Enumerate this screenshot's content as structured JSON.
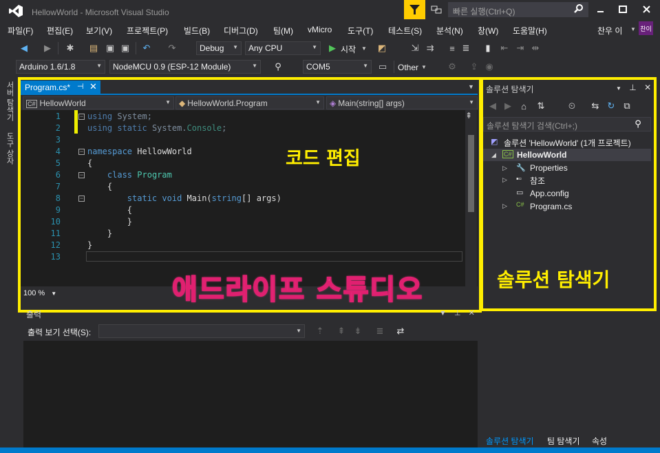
{
  "titlebar": {
    "title": "HellowWorld - Microsoft Visual Studio",
    "quick_launch_placeholder": "빠른 실행(Ctrl+Q)"
  },
  "menu": {
    "items": [
      "파일(F)",
      "편집(E)",
      "보기(V)",
      "프로젝트(P)",
      "빌드(B)",
      "디버그(D)",
      "팀(M)",
      "vMicro",
      "도구(T)",
      "테스트(S)",
      "분석(N)",
      "창(W)",
      "도움말(H)"
    ],
    "user_name": "찬우 이",
    "user_initials": "찬이"
  },
  "toolbar": {
    "config": "Debug",
    "platform": "Any CPU",
    "start_label": "시작",
    "board": "Arduino 1.6/1.8",
    "device": "NodeMCU 0.9 (ESP-12 Module)",
    "port": "COM5",
    "other_label": "Other"
  },
  "left_strip": {
    "tab1": "서버 탐색기",
    "tab2": "도구 상자"
  },
  "editor": {
    "tab_label": "Program.cs*",
    "nav_project": "HellowWorld",
    "nav_class": "HellowWorld.Program",
    "nav_member": "Main(string[] args)",
    "line_numbers": [
      "1",
      "2",
      "3",
      "4",
      "5",
      "6",
      "7",
      "8",
      "9",
      "10",
      "11",
      "12",
      "13"
    ],
    "lines": [
      "using System;",
      "using static System.Console;",
      "",
      "namespace HellowWorld",
      "{",
      "    class Program",
      "    {",
      "        static void Main(string[] args)",
      "        {",
      "        }",
      "    }",
      "}",
      ""
    ],
    "zoom": "100 %"
  },
  "annotations": {
    "code_edit": "코드 편집",
    "solution_explorer": "솔루션 탐색기",
    "brand": "애드라이프 스튜디오"
  },
  "output": {
    "title": "출력",
    "source_label": "출력 보기 선택(S):"
  },
  "solution_explorer": {
    "title": "솔루션 탐색기",
    "search_placeholder": "솔루션 탐색기 검색(Ctrl+;)",
    "tree": {
      "solution": "솔루션 'HellowWorld' (1개 프로젝트)",
      "project": "HellowWorld",
      "properties": "Properties",
      "references": "참조",
      "app_config": "App.config",
      "program_cs": "Program.cs"
    },
    "bottom_tabs": [
      "솔루션 탐색기",
      "팀 탐색기",
      "속성"
    ]
  },
  "colors": {
    "accent": "#007acc",
    "highlight": "#ffee00",
    "brand_pink": "#f7a8c8"
  }
}
